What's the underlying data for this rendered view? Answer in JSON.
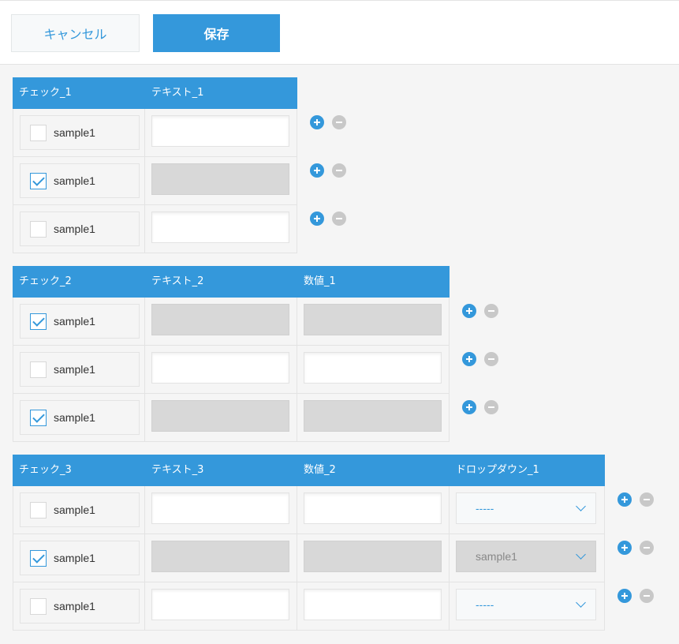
{
  "toolbar": {
    "cancel_label": "キャンセル",
    "save_label": "保存"
  },
  "tables": [
    {
      "headers": [
        "チェック_1",
        "テキスト_1"
      ],
      "rows": [
        {
          "checkbox": {
            "label": "sample1",
            "checked": false
          },
          "text": {
            "value": "",
            "disabled": false
          }
        },
        {
          "checkbox": {
            "label": "sample1",
            "checked": true
          },
          "text": {
            "value": "",
            "disabled": true
          }
        },
        {
          "checkbox": {
            "label": "sample1",
            "checked": false
          },
          "text": {
            "value": "",
            "disabled": false
          }
        }
      ]
    },
    {
      "headers": [
        "チェック_2",
        "テキスト_2",
        "数値_1"
      ],
      "rows": [
        {
          "checkbox": {
            "label": "sample1",
            "checked": true
          },
          "text": {
            "value": "",
            "disabled": true
          },
          "number": {
            "value": "",
            "disabled": true
          }
        },
        {
          "checkbox": {
            "label": "sample1",
            "checked": false
          },
          "text": {
            "value": "",
            "disabled": false
          },
          "number": {
            "value": "",
            "disabled": false
          }
        },
        {
          "checkbox": {
            "label": "sample1",
            "checked": true
          },
          "text": {
            "value": "",
            "disabled": true
          },
          "number": {
            "value": "",
            "disabled": true
          }
        }
      ]
    },
    {
      "headers": [
        "チェック_3",
        "テキスト_3",
        "数値_2",
        "ドロップダウン_1"
      ],
      "rows": [
        {
          "checkbox": {
            "label": "sample1",
            "checked": false
          },
          "text": {
            "value": "",
            "disabled": false
          },
          "number": {
            "value": "",
            "disabled": false
          },
          "dropdown": {
            "value": "-----",
            "disabled": false
          }
        },
        {
          "checkbox": {
            "label": "sample1",
            "checked": true
          },
          "text": {
            "value": "",
            "disabled": true
          },
          "number": {
            "value": "",
            "disabled": true
          },
          "dropdown": {
            "value": "sample1",
            "disabled": true
          }
        },
        {
          "checkbox": {
            "label": "sample1",
            "checked": false
          },
          "text": {
            "value": "",
            "disabled": false
          },
          "number": {
            "value": "",
            "disabled": false
          },
          "dropdown": {
            "value": "-----",
            "disabled": false
          }
        }
      ]
    }
  ],
  "icons": {
    "add_row": "plus-circle-icon",
    "remove_row": "minus-circle-icon",
    "dropdown": "chevron-down-icon",
    "checkmark": "check-icon"
  },
  "colors": {
    "accent": "#3498db",
    "disabled_field": "#d8d8d8",
    "remove_button": "#c8c8c8",
    "background": "#f5f5f5"
  }
}
